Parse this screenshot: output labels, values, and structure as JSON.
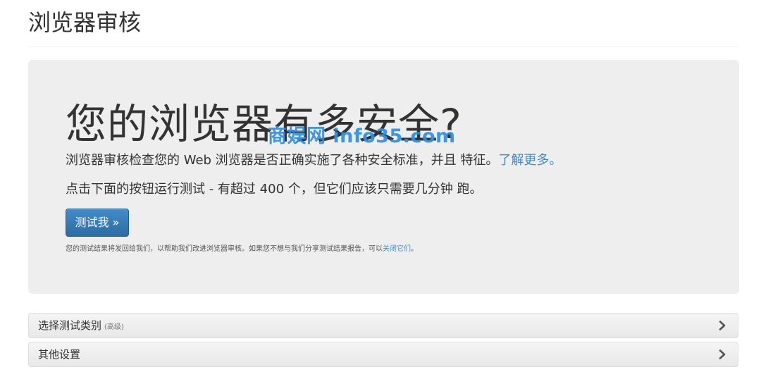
{
  "page": {
    "title": "浏览器审核"
  },
  "hero": {
    "heading": "您的浏览器有多安全?",
    "description": "浏览器审核检查您的 Web 浏览器是否正确实施了各种安全标准，并且 特征。",
    "learn_more": "了解更多。",
    "test_count_text": "点击下面的按钮运行测试 - 有超过 400 个，但它们应该只需要几分钟 跑。",
    "test_button": "测试我 »",
    "note_text": "您的测试结果将发回给我们，以帮助我们改进浏览器审核。如果您不想与我们分享测试结果报告，可以",
    "note_link": "关闭它们",
    "note_end": "。"
  },
  "watermark": "商娱网 info35.com",
  "panels": [
    {
      "label": "选择测试类别",
      "sublabel": "(高级)",
      "icon": "chevron-right-icon"
    },
    {
      "label": "其他设置",
      "sublabel": "",
      "icon": "chevron-right-icon"
    }
  ],
  "colors": {
    "accent": "#428bca",
    "button_dark": "#2d6ca2",
    "jumbotron_bg": "#eeeeee",
    "watermark": "#2c8fe6"
  }
}
